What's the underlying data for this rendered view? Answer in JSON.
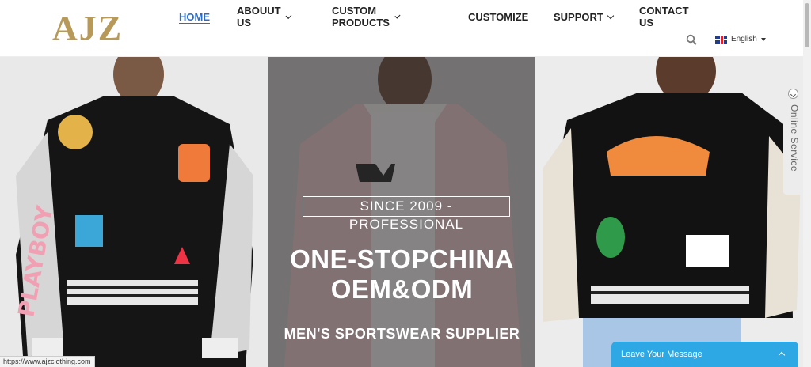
{
  "brand": {
    "logo_text": "AJZ",
    "logo_color": "#b79a5a"
  },
  "nav": {
    "items": [
      {
        "label": "HOME",
        "active": true,
        "dropdown": false
      },
      {
        "label": "ABOUUT US",
        "active": false,
        "dropdown": true
      },
      {
        "label": "CUSTOM PRODUCTS",
        "active": false,
        "dropdown": true
      },
      {
        "label": "CUSTOMIZE",
        "active": false,
        "dropdown": false
      },
      {
        "label": "SUPPORT",
        "active": false,
        "dropdown": true
      },
      {
        "label": "CONTACT US",
        "active": false,
        "dropdown": false
      }
    ],
    "active_color": "#2b6cc4"
  },
  "header_tools": {
    "search_icon": "search-icon",
    "language": "English",
    "flag": "uk-flag-icon"
  },
  "hero": {
    "badge": "SINCE 2009 -PROFESSIONAL",
    "headline_line1": "ONE-STOPCHINA",
    "headline_line2": "OEM&ODM",
    "subline": "MEN'S SPORTSWEAR SUPPLIER"
  },
  "online_service": {
    "label": "Online Service"
  },
  "leave_message": {
    "label": "Leave Your Message"
  },
  "status_bar": {
    "url": "https://www.ajzclothing.com"
  }
}
